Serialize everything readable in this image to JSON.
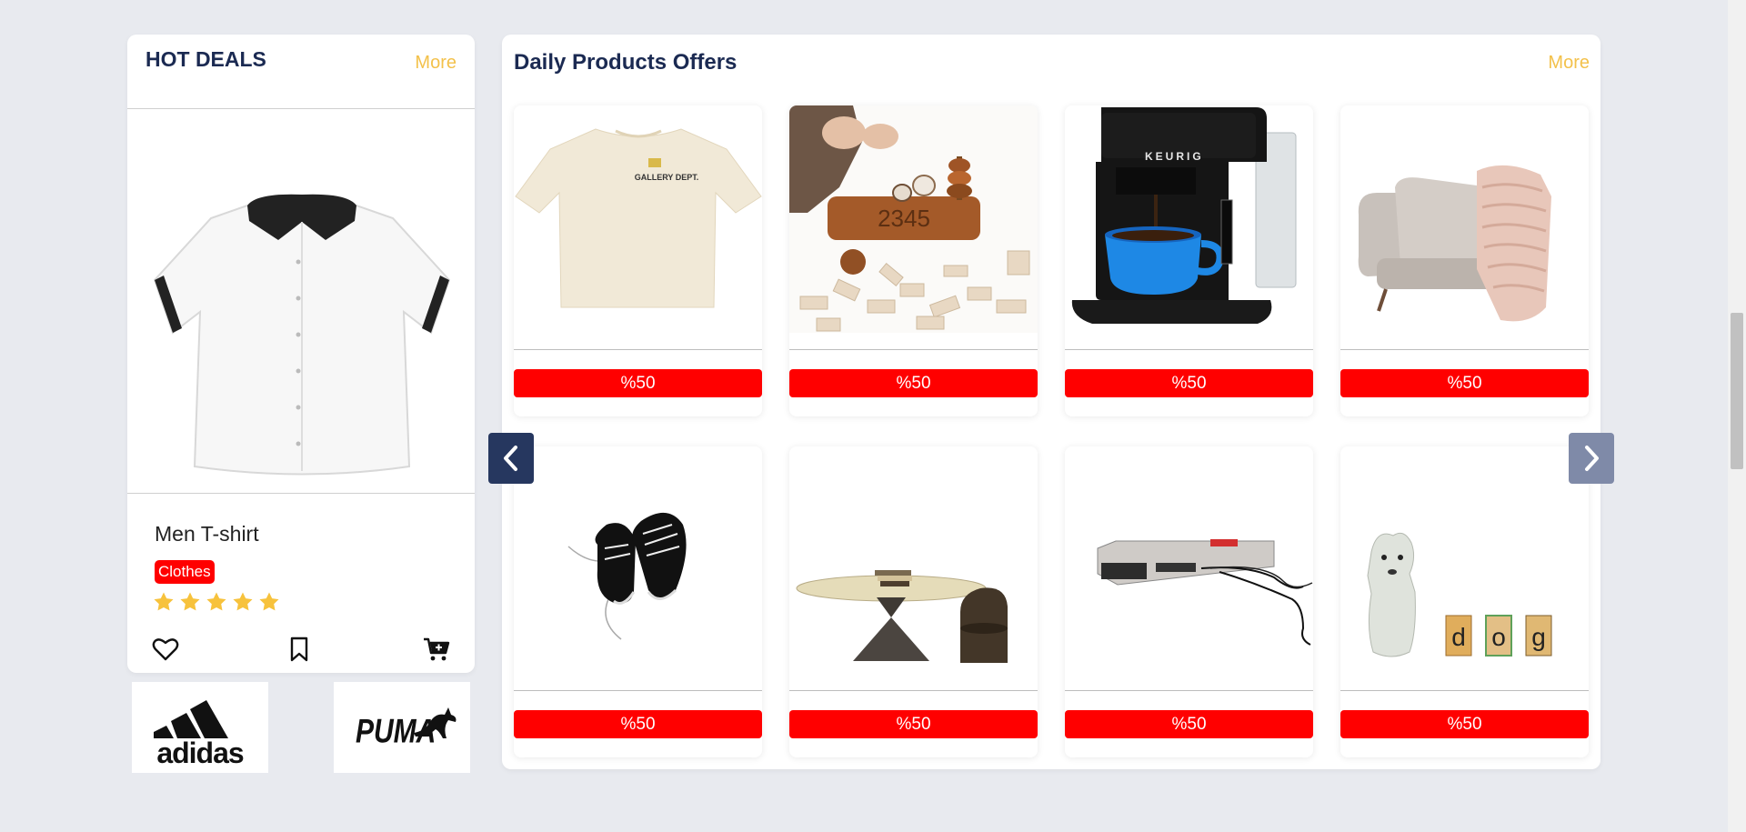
{
  "hot_deals": {
    "title": "HOT DEALS",
    "more_label": "More",
    "product": {
      "name": "Men T-shirt",
      "category": "Clothes",
      "rating": 5,
      "rating_max": 5,
      "image_icon": "white-shirt-image"
    },
    "actions": [
      "heart-icon",
      "bookmark-icon",
      "add-to-cart-icon"
    ],
    "brands": [
      "adidas",
      "PUMA"
    ]
  },
  "daily_offers": {
    "title": "Daily Products Offers",
    "more_label": "More",
    "products": [
      {
        "image": "tshirt-image",
        "brand_text": "GALLERY DEPT.",
        "discount": "%50"
      },
      {
        "image": "wooden-toys-image",
        "digits": "2345",
        "discount": "%50"
      },
      {
        "image": "coffee-maker-image",
        "brand_text": "KEURIG",
        "discount": "%50"
      },
      {
        "image": "armchair-image",
        "discount": "%50"
      },
      {
        "image": "sneakers-image",
        "discount": "%50"
      },
      {
        "image": "coffee-table-image",
        "discount": "%50"
      },
      {
        "image": "game-console-image",
        "discount": "%50"
      },
      {
        "image": "dog-figurine-image",
        "blocks": [
          "d",
          "o",
          "g"
        ],
        "discount": "%50"
      }
    ]
  },
  "colors": {
    "navy": "#1b2a52",
    "accent_yellow": "#f3c14b",
    "discount_red": "#ff0000",
    "star": "#f7c23c"
  }
}
